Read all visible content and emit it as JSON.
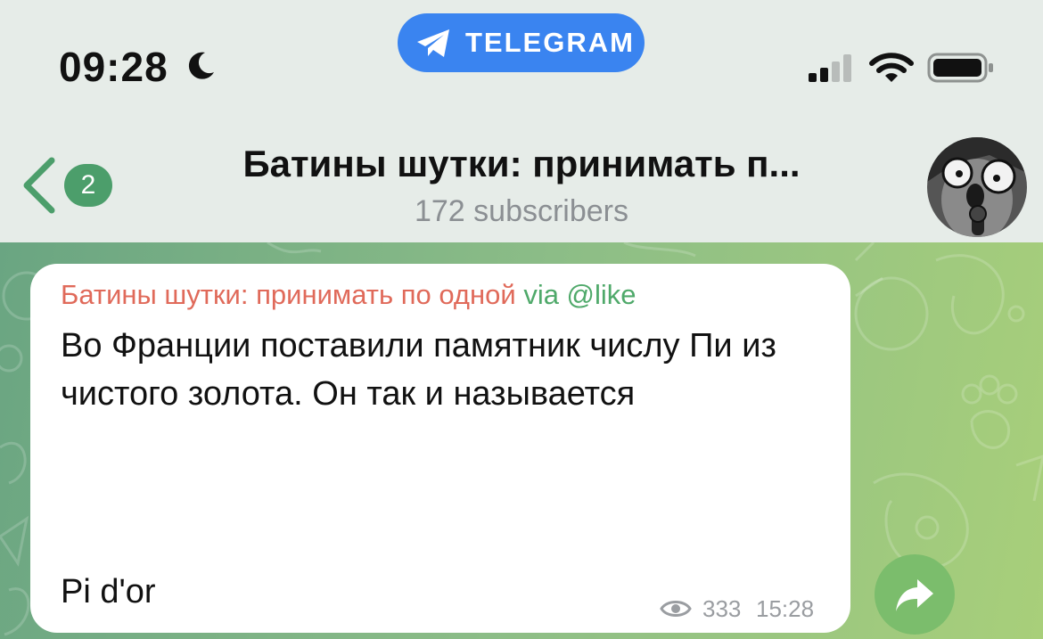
{
  "status_bar": {
    "time": "09:28",
    "moon_icon": "moon-icon",
    "app_pill_label": "TELEGRAM",
    "app_pill_color": "#3a84f0"
  },
  "header": {
    "unread_count": "2",
    "title": "Батины шутки: принимать п...",
    "subtitle": "172 subscribers"
  },
  "message": {
    "sender_name": "Батины шутки: принимать по одной",
    "via": "via @like",
    "text": "Во Франции поставили памятник числу Пи из чистого золота. Он так и называется",
    "punchline": "Pi d'or",
    "views": "333",
    "time": "15:28"
  },
  "colors": {
    "sender": "#e06a5a",
    "via": "#4fa96a",
    "badge": "#4c9e6b",
    "share_button": "#7bbd6c"
  }
}
